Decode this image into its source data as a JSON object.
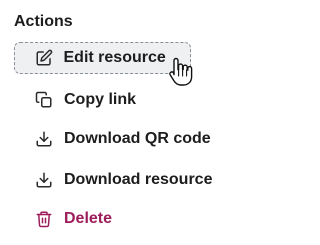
{
  "menu": {
    "title": "Actions",
    "items": [
      {
        "label": "Edit resource",
        "icon": "edit-icon"
      },
      {
        "label": "Copy link",
        "icon": "copy-icon"
      },
      {
        "label": "Download QR code",
        "icon": "download-icon"
      },
      {
        "label": "Download resource",
        "icon": "download-icon"
      },
      {
        "label": "Delete",
        "icon": "trash-icon"
      }
    ],
    "colors": {
      "text": "#1d1d1d",
      "danger": "#9c1d5a",
      "hover_background": "#eef0f2",
      "focus_outline": "#8a8f96"
    }
  },
  "cursor": {
    "icon": "hand-pointer-icon"
  }
}
